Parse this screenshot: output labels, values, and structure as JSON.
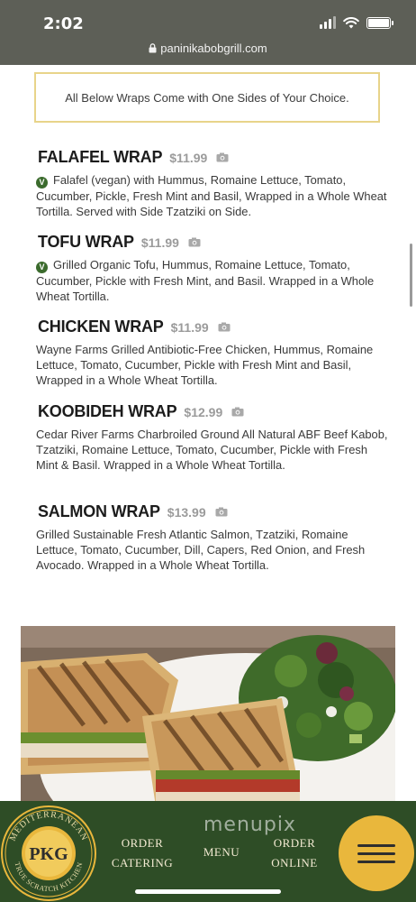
{
  "status_bar": {
    "time": "2:02",
    "battery_level": 1.0
  },
  "browser": {
    "url": "paninikabobgrill.com"
  },
  "notice": "All Below Wraps Come with One Sides of Your Choice.",
  "menu_items": [
    {
      "name": "FALAFEL WRAP",
      "price": "$11.99",
      "vegan_badge": "V",
      "description": "Falafel (vegan) with Hummus, Romaine Lettuce, Tomato, Cucumber, Pickle, Fresh Mint and Basil, Wrapped in a Whole Wheat Tortilla. Served with Side Tzatziki on Side."
    },
    {
      "name": "TOFU WRAP",
      "price": "$11.99",
      "vegan_badge": "V",
      "description": "Grilled Organic Tofu, Hummus, Romaine Lettuce, Tomato, Cucumber, Pickle with Fresh Mint, and Basil. Wrapped in a Whole Wheat Tortilla."
    },
    {
      "name": "CHICKEN WRAP",
      "price": "$11.99",
      "description": "Wayne Farms Grilled Antibiotic-Free Chicken, Hummus, Romaine Lettuce, Tomato, Cucumber, Pickle with Fresh Mint and Basil, Wrapped in a Whole Wheat Tortilla."
    },
    {
      "name": "KOOBIDEH WRAP",
      "price": "$12.99",
      "description": "Cedar River Farms Charbroiled Ground All Natural ABF Beef Kabob, Tzatziki, Romaine Lettuce, Tomato, Cucumber, Pickle with Fresh Mint & Basil. Wrapped in a Whole Wheat Tortilla."
    },
    {
      "name": "SALMON WRAP",
      "price": "$13.99",
      "description": "Grilled Sustainable Fresh Atlantic Salmon, Tzatziki, Romaine Lettuce, Tomato, Cucumber, Dill, Capers, Red Onion, and Fresh Avocado. Wrapped in a Whole Wheat Tortilla."
    }
  ],
  "icons": {
    "photo": "camera-icon",
    "vegan": "vegan-badge",
    "menu": "hamburger-icon",
    "secure": "lock-icon"
  },
  "logo": {
    "initials": "PKG",
    "ring_top": "MEDITERRANEAN",
    "ring_bottom": "TRUE SCRATCH KITCHEN"
  },
  "bottom_nav": {
    "order_catering": [
      "ORDER",
      "CATERING"
    ],
    "menu": "MENU",
    "order_online": [
      "ORDER",
      "ONLINE"
    ]
  },
  "watermark": "menupix",
  "colors": {
    "nav_green": "#2e4d26",
    "accent_gold": "#e9b73c",
    "notice_border": "#e8d48a",
    "vegan_green": "#3b6b2d"
  }
}
